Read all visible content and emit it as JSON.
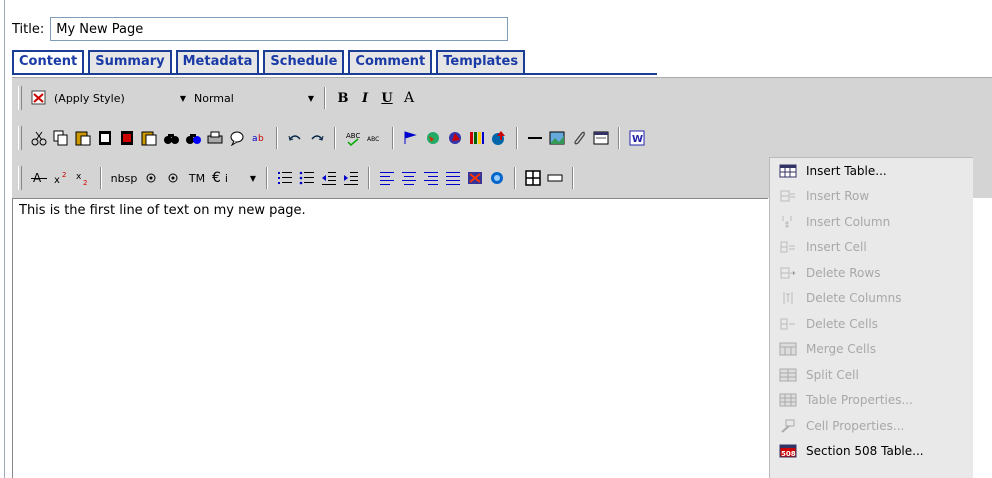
{
  "title": {
    "label": "Title:",
    "value": "My New Page"
  },
  "tabs": [
    {
      "label": "Content",
      "active": true
    },
    {
      "label": "Summary",
      "active": false
    },
    {
      "label": "Metadata",
      "active": false
    },
    {
      "label": "Schedule",
      "active": false
    },
    {
      "label": "Comment",
      "active": false
    },
    {
      "label": "Templates",
      "active": false
    }
  ],
  "toolbar": {
    "style_combo": "(Apply Style)",
    "format_combo": "Normal",
    "bold": "B",
    "italic": "I",
    "underline": "U",
    "font_color": "A",
    "nbsp": "nbsp",
    "tm": "TM",
    "euro": "€",
    "special_char": "i"
  },
  "editor": {
    "text": "This is the first line of text on my new page."
  },
  "table_menu": {
    "items": [
      {
        "label": "Insert Table...",
        "enabled": true,
        "icon": "insert-table-icon"
      },
      {
        "label": "Insert Row",
        "enabled": false,
        "icon": "insert-row-icon"
      },
      {
        "label": "Insert Column",
        "enabled": false,
        "icon": "insert-column-icon"
      },
      {
        "label": "Insert Cell",
        "enabled": false,
        "icon": "insert-cell-icon"
      },
      {
        "label": "Delete Rows",
        "enabled": false,
        "icon": "delete-rows-icon"
      },
      {
        "label": "Delete Columns",
        "enabled": false,
        "icon": "delete-columns-icon"
      },
      {
        "label": "Delete Cells",
        "enabled": false,
        "icon": "delete-cells-icon"
      },
      {
        "label": "Merge Cells",
        "enabled": false,
        "icon": "merge-cells-icon"
      },
      {
        "label": "Split Cell",
        "enabled": false,
        "icon": "split-cell-icon"
      },
      {
        "label": "Table Properties...",
        "enabled": false,
        "icon": "table-properties-icon"
      },
      {
        "label": "Cell Properties...",
        "enabled": false,
        "icon": "cell-properties-icon"
      },
      {
        "label": "Section 508 Table...",
        "enabled": true,
        "icon": "section-508-icon"
      }
    ]
  },
  "colors": {
    "tab_border": "#1c3d96",
    "tab_text": "#1a3aa6",
    "toolbar_bg": "#d4d4d4",
    "menu_bg": "#e9e9e9",
    "disabled_text": "#a8a8a8"
  }
}
